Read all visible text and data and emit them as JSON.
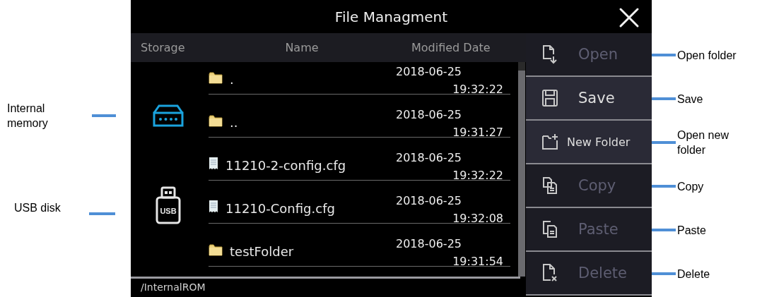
{
  "annotations_left": [
    {
      "text": "Internal memory"
    },
    {
      "text": "USB disk"
    }
  ],
  "window": {
    "title": "File Managment"
  },
  "columns": [
    "Storage",
    "Name",
    "Modified Date"
  ],
  "storage": [
    {
      "kind": "internal",
      "selected": true
    },
    {
      "kind": "usb",
      "selected": false,
      "label": "USB"
    }
  ],
  "files": [
    {
      "kind": "folder",
      "name": ".",
      "date": "2018-06-25",
      "time": "19:32:22"
    },
    {
      "kind": "folder",
      "name": "..",
      "date": "2018-06-25",
      "time": "19:31:27"
    },
    {
      "kind": "file",
      "name": "11210-2-config.cfg",
      "date": "2018-06-25",
      "time": "19:32:22"
    },
    {
      "kind": "file",
      "name": "11210-Config.cfg",
      "date": "2018-06-25",
      "time": "19:32:08"
    },
    {
      "kind": "folder",
      "name": "testFolder",
      "date": "2018-06-25",
      "time": "19:31:54"
    }
  ],
  "status_bar": {
    "path": "/InternalROM"
  },
  "actions": [
    {
      "kind": "open",
      "label": "Open",
      "disabled": true
    },
    {
      "kind": "save",
      "label": "Save",
      "disabled": false
    },
    {
      "kind": "newfolder",
      "label": "New Folder",
      "disabled": false
    },
    {
      "kind": "copy",
      "label": "Copy",
      "disabled": true
    },
    {
      "kind": "paste",
      "label": "Paste",
      "disabled": true
    },
    {
      "kind": "delete",
      "label": "Delete",
      "disabled": true
    }
  ],
  "annotations_right": [
    {
      "text": "Open folder"
    },
    {
      "text": "Save"
    },
    {
      "text": "Open new folder"
    },
    {
      "text": "Copy"
    },
    {
      "text": "Paste"
    },
    {
      "text": "Delete"
    }
  ]
}
